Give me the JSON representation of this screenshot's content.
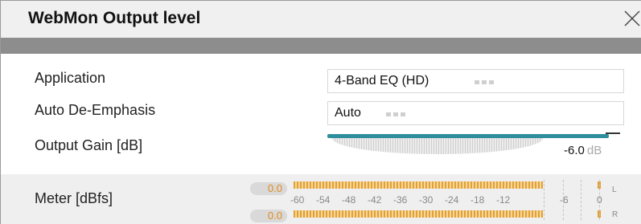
{
  "window": {
    "title": "WebMon Output level"
  },
  "settings": {
    "application": {
      "label": "Application",
      "value": "4-Band EQ (HD)"
    },
    "de_emphasis": {
      "label": "Auto De-Emphasis",
      "value": "Auto"
    },
    "output_gain": {
      "label": "Output Gain [dB]",
      "value": "-6.0",
      "unit": "dB"
    }
  },
  "meter": {
    "label": "Meter [dBfs]",
    "peak_left": "0.0",
    "peak_right": "0.0",
    "scale": [
      "-60",
      "-54",
      "-48",
      "-42",
      "-36",
      "-30",
      "-24",
      "-18",
      "-12",
      "-6",
      "0"
    ],
    "channel_left": "L",
    "channel_right": "R"
  },
  "colors": {
    "accent": "#2e8e9e",
    "meter": "#e3a035",
    "title_bar": "#f0f0f0",
    "separator": "#8d8d8d"
  },
  "icons": {
    "close": "close-icon"
  }
}
